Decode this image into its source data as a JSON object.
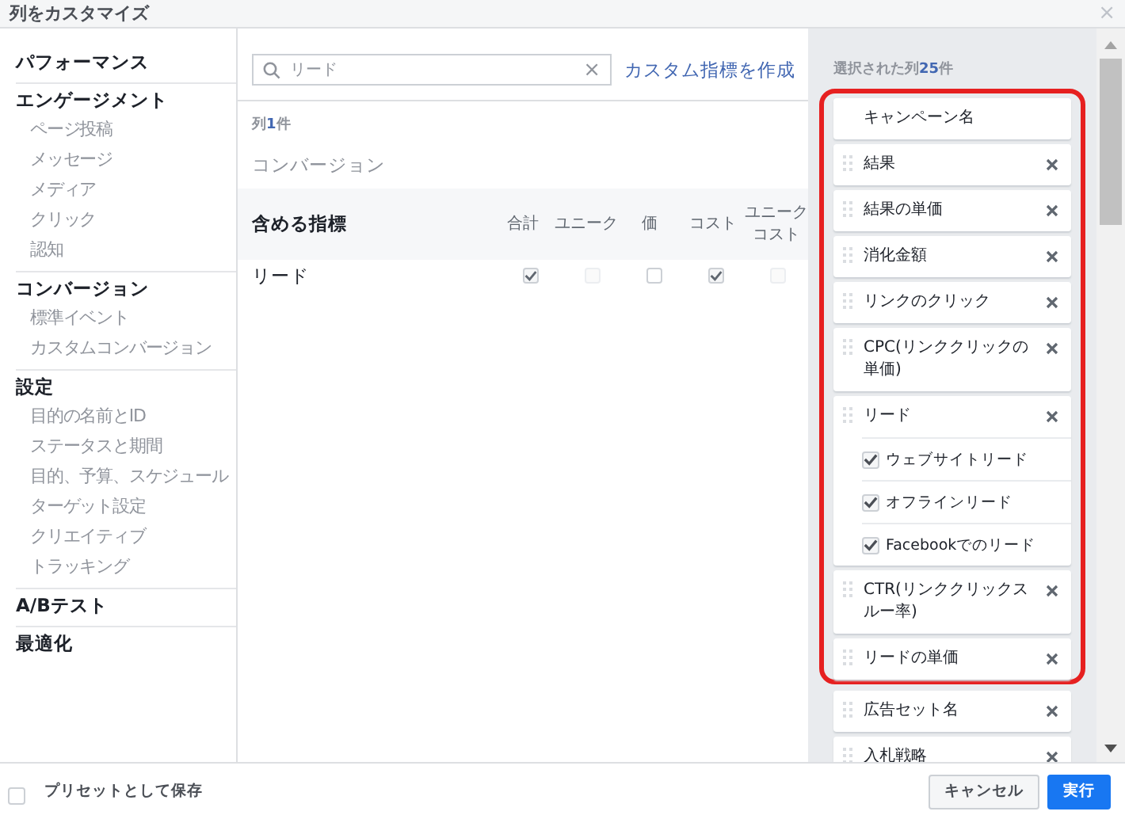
{
  "window": {
    "title": "列をカスタマイズ",
    "close": "×"
  },
  "sidebar": {
    "sections": [
      {
        "label": "パフォーマンス"
      },
      {
        "label": "エンゲージメント",
        "items": [
          "ページ投稿",
          "メッセージ",
          "メディア",
          "クリック",
          "認知"
        ]
      },
      {
        "label": "コンバージョン",
        "items": [
          "標準イベント",
          "カスタムコンバージョン"
        ]
      },
      {
        "label": "設定",
        "items": [
          "目的の名前とID",
          "ステータスと期間",
          "目的、予算、スケジュール",
          "ターゲット設定",
          "クリエイティブ",
          "トラッキング"
        ]
      },
      {
        "label": "A/Bテスト"
      },
      {
        "label": "最適化"
      }
    ]
  },
  "search": {
    "value": "リード",
    "clear": "×"
  },
  "create_link": "カスタム指標を作成",
  "results": {
    "prefix": "列",
    "count": "1",
    "suffix": "件"
  },
  "category": "コンバージョン",
  "table": {
    "title": "含める指標",
    "columns": [
      "合計",
      "ユニーク",
      "価",
      "コスト",
      "ユニークコスト"
    ],
    "rows": [
      {
        "name": "リード",
        "cells": [
          {
            "checked": true,
            "disabled": false
          },
          {
            "checked": false,
            "disabled": true
          },
          {
            "checked": false,
            "disabled": false
          },
          {
            "checked": true,
            "disabled": false
          },
          {
            "checked": false,
            "disabled": true
          }
        ]
      }
    ]
  },
  "selected": {
    "prefix": "選択された列",
    "count": "25",
    "suffix": "件",
    "highlighted_columns": [
      {
        "label": "キャンペーン名",
        "removable": false
      },
      {
        "label": "結果",
        "removable": true
      },
      {
        "label": "結果の単価",
        "removable": true
      },
      {
        "label": "消化金額",
        "removable": true
      },
      {
        "label": "リンクのクリック",
        "removable": true
      },
      {
        "label": "CPC(リンククリックの単価)",
        "removable": true
      },
      {
        "label": "リード",
        "removable": true,
        "options": [
          {
            "label": "ウェブサイトリード",
            "checked": true
          },
          {
            "label": "オフラインリード",
            "checked": true
          },
          {
            "label": "Facebookでのリード",
            "checked": true
          }
        ]
      },
      {
        "label": "CTR(リンククリックスルー率)",
        "removable": true
      },
      {
        "label": "リードの単価",
        "removable": true
      }
    ],
    "columns": [
      {
        "label": "広告セット名",
        "removable": true
      },
      {
        "label": "入札戦略",
        "removable": true
      }
    ]
  },
  "footer": {
    "preset": {
      "label": "プリセットとして保存",
      "checked": false
    },
    "buttons": [
      {
        "label": "キャンセル",
        "kind": "secondary"
      },
      {
        "label": "実行",
        "kind": "primary"
      }
    ]
  }
}
